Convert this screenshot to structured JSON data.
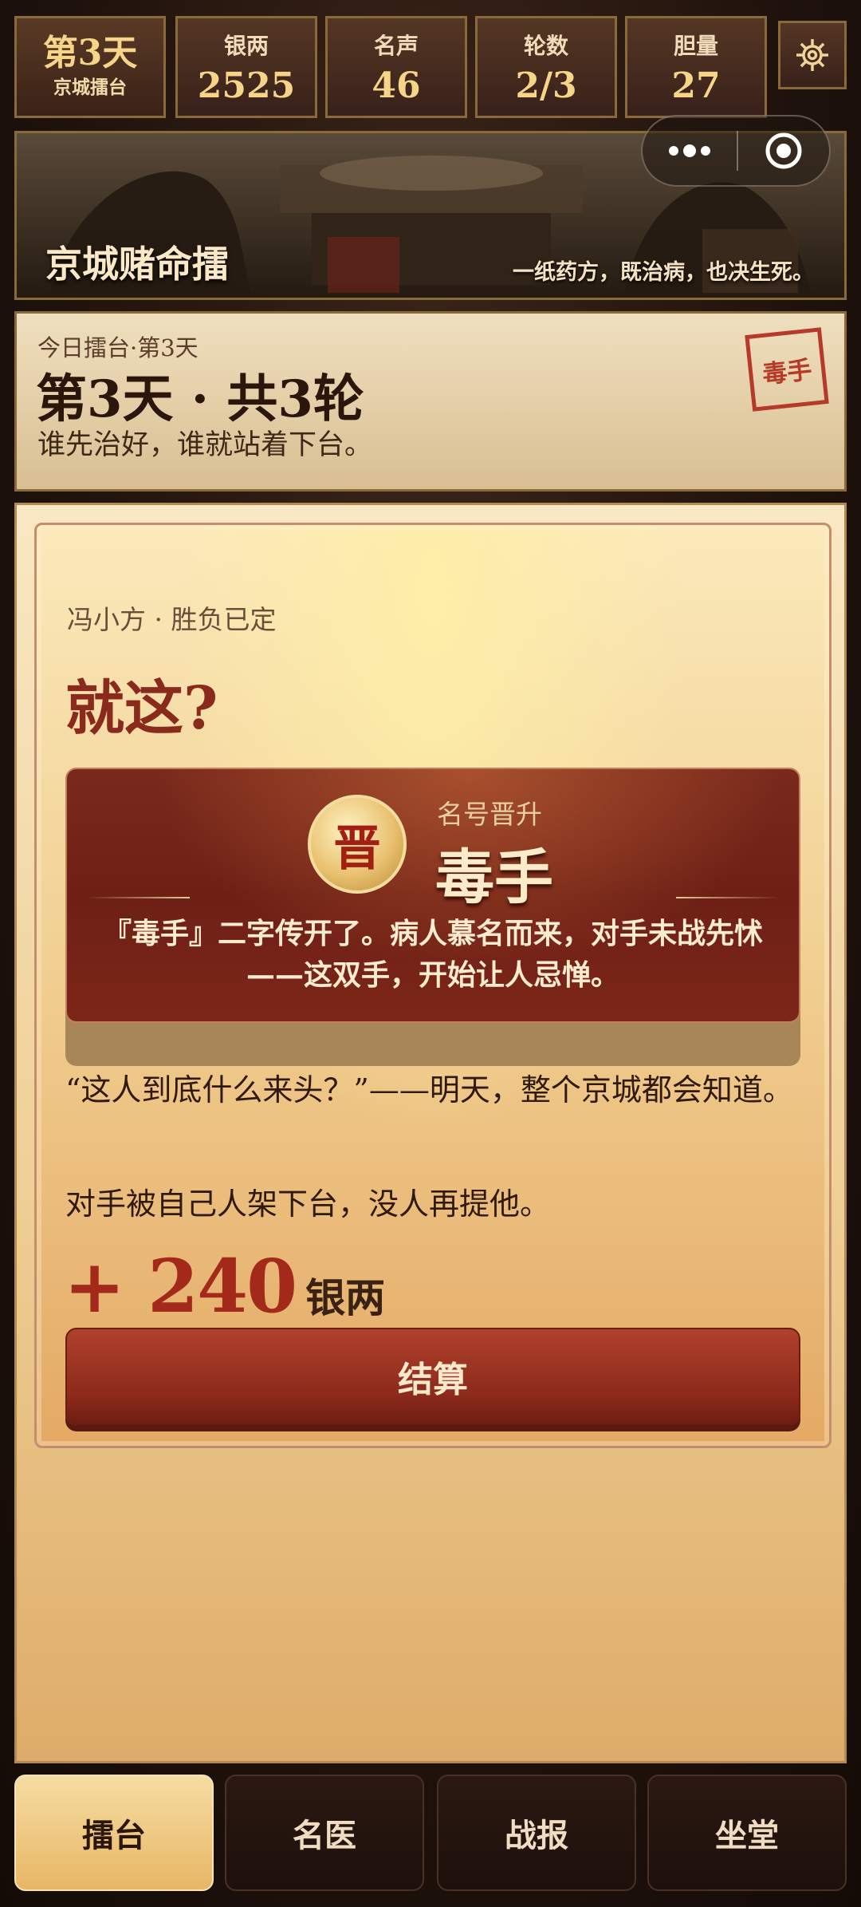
{
  "top": {
    "day_big": "第3天",
    "day_small": "京城擂台",
    "stats": [
      {
        "label": "银两",
        "value": "2525"
      },
      {
        "label": "名声",
        "value": "46"
      },
      {
        "label": "轮数",
        "value": "2/3"
      },
      {
        "label": "胆量",
        "value": "27"
      }
    ],
    "settings_icon": "gear-icon"
  },
  "banner": {
    "title": "京城赌命擂",
    "motto": "一纸药方，既治病，也决生死。"
  },
  "daycard": {
    "sub": "今日擂台·第3天",
    "head": "第3天 · 共3轮",
    "desc": "谁先治好，谁就站着下台。",
    "stamp": "毒手"
  },
  "result": {
    "who": "冯小方 · 胜负已定",
    "exclaim": "就这?",
    "promo": {
      "seal": "晋",
      "label": "名号晋升",
      "title": "毒手",
      "desc": "『毒手』二字传开了。病人慕名而来，对手未战先怵——这双手，开始让人忌惮。"
    },
    "quote": "“这人到底什么来头？”——明天，整个京城都会知道。",
    "note": "对手被自己人架下台，没人再提他。",
    "reward_value": "+ 240",
    "reward_unit": "银两",
    "settle_label": "结算"
  },
  "nav": {
    "tabs": [
      "擂台",
      "名医",
      "战报",
      "坐堂"
    ],
    "active": 0
  },
  "colors": {
    "accent_red": "#a3291a",
    "gold": "#f6d488",
    "dark_brown": "#1f120c"
  }
}
